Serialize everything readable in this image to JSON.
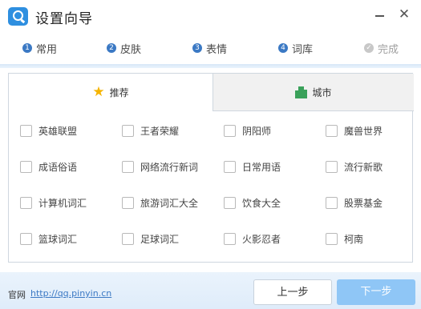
{
  "window": {
    "title": "设置向导",
    "close_glyph": "✕"
  },
  "steps": [
    {
      "num": "1",
      "label": "常用",
      "state": "active"
    },
    {
      "num": "2",
      "label": "皮肤",
      "state": "active"
    },
    {
      "num": "3",
      "label": "表情",
      "state": "active"
    },
    {
      "num": "4",
      "label": "词库",
      "state": "current"
    },
    {
      "num": "✓",
      "label": "完成",
      "state": "pending"
    }
  ],
  "tabs": {
    "recommend": "推荐",
    "city": "城市"
  },
  "dictionaries": [
    [
      "英雄联盟",
      "王者荣耀",
      "阴阳师",
      "魔兽世界"
    ],
    [
      "成语俗语",
      "网络流行新词",
      "日常用语",
      "流行新歌"
    ],
    [
      "计算机词汇",
      "旅游词汇大全",
      "饮食大全",
      "股票基金"
    ],
    [
      "篮球词汇",
      "足球词汇",
      "火影忍者",
      "柯南"
    ]
  ],
  "footer": {
    "site_label": "官网",
    "site_link": "http://qq.pinyin.cn",
    "prev_label": "上一步",
    "next_label": "下一步"
  },
  "colors": {
    "accent": "#3b79c4",
    "next_button": "#8fc6f6",
    "star": "#f5b400",
    "city_icon": "#3aa15a"
  }
}
